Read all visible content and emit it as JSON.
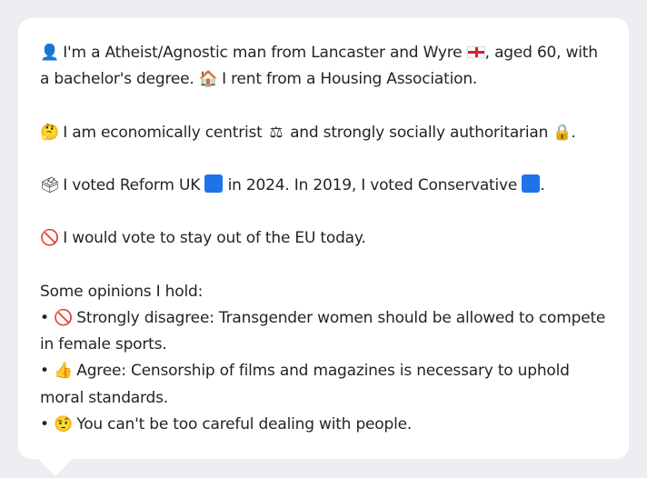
{
  "profile": {
    "p1": {
      "icon_person": "person-silhouette-icon",
      "t1": "I'm a Atheist/Agnostic man from Lancaster and Wyre",
      "flag": "england-flag-icon",
      "t2": ", aged 60, with a bachelor's degree.",
      "icon_house": "house-icon",
      "t3": "I rent from a Housing Association."
    },
    "p2": {
      "icon": "thinking-face-icon",
      "t1": "I am economically centrist",
      "icon_scales": "balance-scale-icon",
      "t2": "and strongly socially authoritarian",
      "icon_lock": "padlock-icon",
      "t3": "."
    },
    "p3": {
      "icon": "ballot-box-icon",
      "t1": "I voted Reform UK",
      "t2": "in 2024. In 2019, I voted Conservative",
      "t3": "."
    },
    "p4": {
      "icon": "prohibited-icon",
      "t1": "I would vote to stay out of the EU today."
    },
    "opinions": {
      "heading": "Some opinions I hold:",
      "items": [
        {
          "icon": "prohibited-icon",
          "text": "Strongly disagree: Transgender women should be allowed to compete in female sports."
        },
        {
          "icon": "thumbs-up-icon",
          "text": "Agree: Censorship of films and magazines is necessary to uphold moral standards."
        },
        {
          "icon": "raised-eyebrow-face-icon",
          "text": "You can't be too careful dealing with people."
        }
      ]
    }
  },
  "colors": {
    "background": "#eceef1",
    "card": "#ffffff",
    "text": "#1f2328",
    "party_blue": "#1f73e8",
    "flag_red": "#d4202c"
  }
}
